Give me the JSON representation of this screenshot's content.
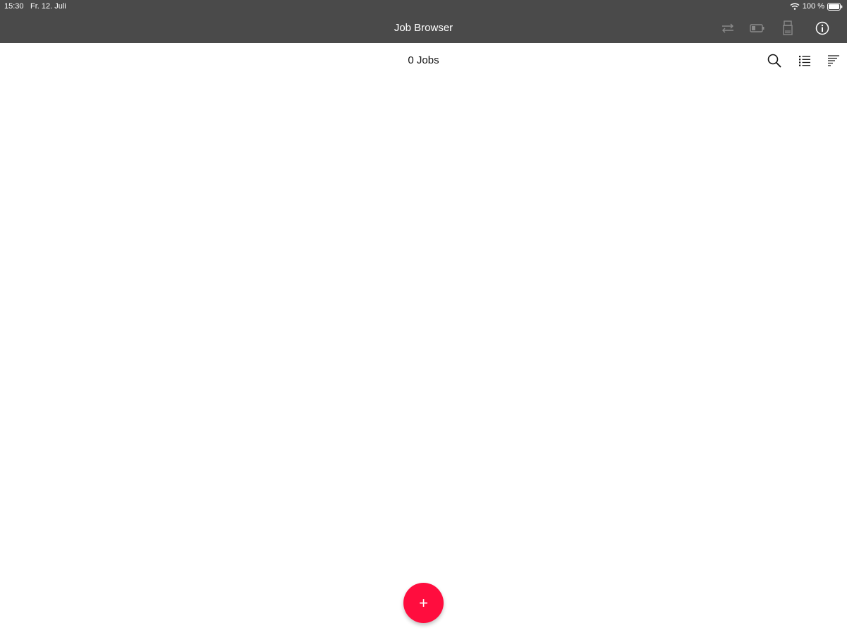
{
  "status_bar": {
    "time": "15:30",
    "date": "Fr. 12. Juli",
    "battery_text": "100 %",
    "wifi_icon": "wifi-icon",
    "battery_icon": "battery-full-icon"
  },
  "nav_bar": {
    "title": "Job Browser",
    "background_color": "#4a4a4a",
    "icons": [
      "sync-icon",
      "battery-device-icon",
      "printer-device-icon",
      "info-icon"
    ]
  },
  "subheader": {
    "job_count": "0 Jobs",
    "icons": [
      "search-icon",
      "list-view-icon",
      "sort-icon"
    ]
  },
  "fab": {
    "label": "+",
    "icon": "plus-icon",
    "color": "#ff0d3e"
  }
}
